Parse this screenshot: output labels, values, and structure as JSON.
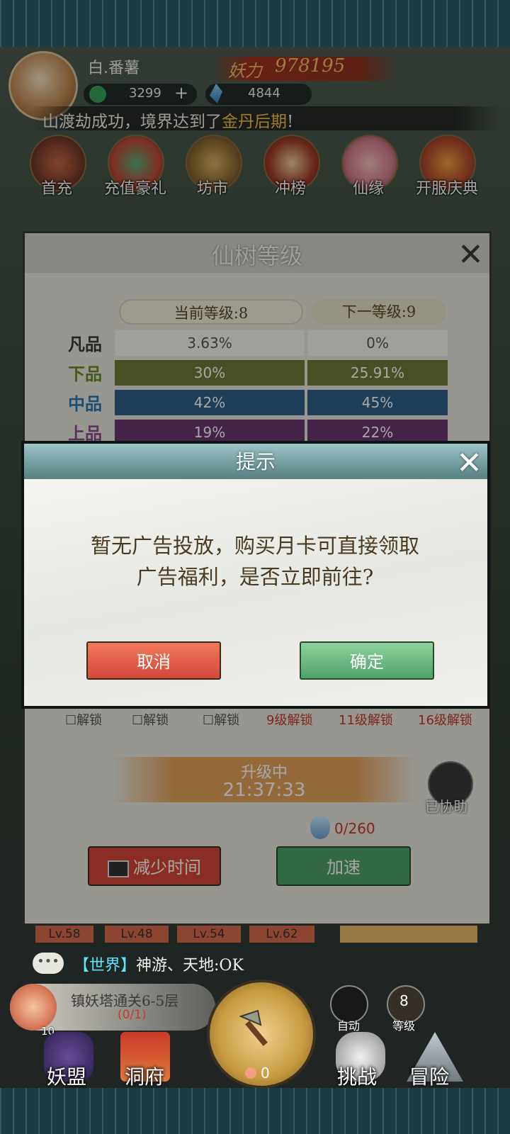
{
  "header": {
    "player_name": "白.番薯",
    "power_label": "妖力",
    "power_value": "978195",
    "currency": [
      {
        "icon": "jade-icon",
        "value": "3299",
        "add": "+"
      },
      {
        "icon": "crystal-icon",
        "value": "4844"
      }
    ],
    "notice_prefix": "山渡劫成功，境界达到了",
    "notice_highlight": "金丹后期",
    "notice_suffix": "!"
  },
  "activities": [
    {
      "label": "首充",
      "icon": "dragon-icon"
    },
    {
      "label": "充值豪礼",
      "icon": "gift-bag-icon"
    },
    {
      "label": "坊市",
      "icon": "coin-icon"
    },
    {
      "label": "冲榜",
      "icon": "gate-icon"
    },
    {
      "label": "仙缘",
      "icon": "lotus-icon"
    },
    {
      "label": "开服庆典",
      "icon": "gift-box-icon"
    }
  ],
  "tree_panel": {
    "title": "仙树等级",
    "current_level": "当前等级:8",
    "next_level": "下一等级:9",
    "rows": [
      {
        "label": "凡品",
        "current": "3.63%",
        "next": "0%",
        "color": "#f2f2ee",
        "label_color": "#3a3a3a"
      },
      {
        "label": "下品",
        "current": "30%",
        "next": "25.91%",
        "color": "#6f7a3a",
        "label_color": "#6a8a2a"
      },
      {
        "label": "中品",
        "current": "42%",
        "next": "45%",
        "color": "#2f5f86",
        "label_color": "#2a7ab0"
      },
      {
        "label": "上品",
        "current": "19%",
        "next": "22%",
        "color": "#6a3a6e",
        "label_color": "#8a4a90"
      }
    ],
    "unlocks": [
      "解锁",
      "解锁",
      "解锁",
      "9级解锁",
      "11级解锁",
      "16级解锁"
    ],
    "upgrade_label": "升级中",
    "upgrade_timer": "21:37:33",
    "assist_label": "已协助",
    "cost": "0/260",
    "reduce_time_label": "减少时间",
    "speedup_label": "加速"
  },
  "levels_row": [
    "Lv.58",
    "Lv.48",
    "Lv.54",
    "Lv.62"
  ],
  "modal": {
    "title": "提示",
    "message_line1": "暂无广告投放，购买月卡可直接领取",
    "message_line2": "广告福利，是否立即前往?",
    "cancel_label": "取消",
    "confirm_label": "确定"
  },
  "chat": {
    "icon_text": "•••",
    "channel": "【世界】",
    "message": "神游、天地:OK"
  },
  "quest": {
    "title": "镇妖塔通关6-5层",
    "progress": "(0/1)",
    "badge": "10"
  },
  "hud": {
    "auto_label": "自动",
    "level_value": "8",
    "level_label": "等级",
    "peach_count": "0"
  },
  "bottom_nav": [
    {
      "label": "妖盟",
      "icon": "alliance-icon"
    },
    {
      "label": "洞府",
      "icon": "cave-icon"
    },
    {
      "label": "挑战",
      "icon": "challenge-icon"
    },
    {
      "label": "冒险",
      "icon": "mountain-icon"
    }
  ]
}
